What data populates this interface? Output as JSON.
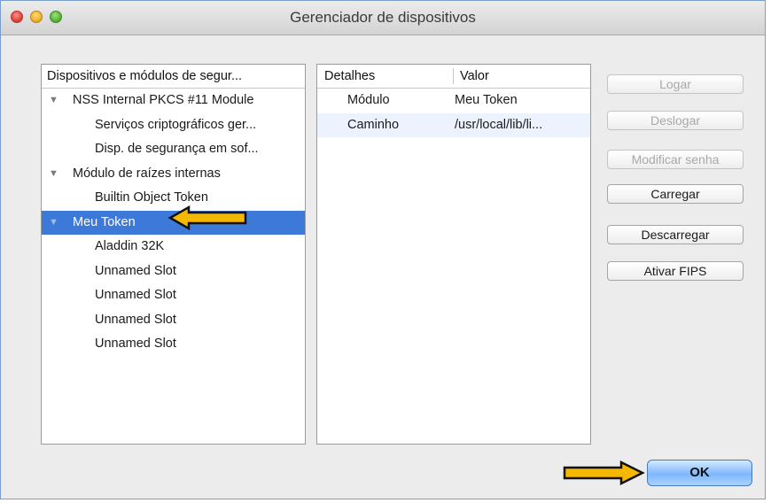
{
  "window": {
    "title": "Gerenciador de dispositivos"
  },
  "tree": {
    "header": "Dispositivos e módulos de segur...",
    "items": [
      {
        "label": "NSS Internal PKCS #11 Module",
        "expander": "▼"
      },
      {
        "label": "Serviços criptográficos ger..."
      },
      {
        "label": "Disp. de segurança em sof..."
      },
      {
        "label": "Módulo de raízes internas",
        "expander": "▼"
      },
      {
        "label": "Builtin Object Token"
      },
      {
        "label": "Meu Token",
        "expander": "▼",
        "selected": true
      },
      {
        "label": "Aladdin 32K"
      },
      {
        "label": "Unnamed Slot"
      },
      {
        "label": "Unnamed Slot"
      },
      {
        "label": "Unnamed Slot"
      },
      {
        "label": "Unnamed Slot"
      }
    ]
  },
  "details": {
    "headers": [
      "Detalhes",
      "Valor"
    ],
    "rows": [
      [
        "Módulo",
        "Meu Token"
      ],
      [
        "Caminho",
        "/usr/local/lib/li..."
      ]
    ]
  },
  "buttons": {
    "logar": "Logar",
    "deslogar": "Deslogar",
    "modificar_senha": "Modificar senha",
    "carregar": "Carregar",
    "descarregar": "Descarregar",
    "ativar_fips": "Ativar FIPS",
    "ok": "OK"
  },
  "colors": {
    "selection": "#3d79d8",
    "annotation_arrow": "#f5b800",
    "ok_button": "#7fb7ff"
  }
}
